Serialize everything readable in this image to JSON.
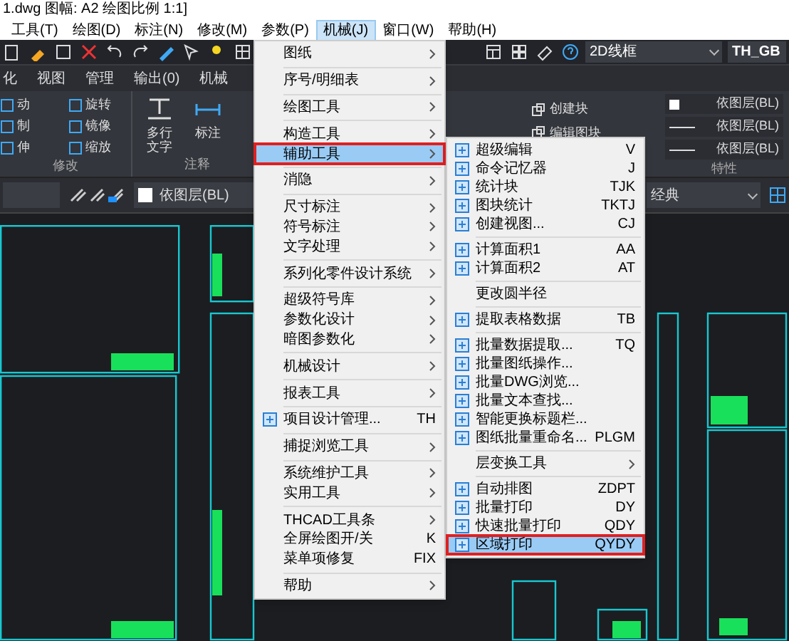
{
  "window": {
    "title": "1.dwg 图幅: A2 绘图比例 1:1]"
  },
  "menu_bar": [
    {
      "label": "工具(T)",
      "selected": false
    },
    {
      "label": "绘图(D)",
      "selected": false
    },
    {
      "label": "标注(N)",
      "selected": false
    },
    {
      "label": "修改(M)",
      "selected": false
    },
    {
      "label": "参数(P)",
      "selected": false
    },
    {
      "label": "机械(J)",
      "selected": true
    },
    {
      "label": "窗口(W)",
      "selected": false
    },
    {
      "label": "帮助(H)",
      "selected": false
    }
  ],
  "toolbar": {
    "visual_style": "2D线框",
    "text_style": "TH_GB"
  },
  "ribbon_tabs": [
    "化",
    "视图",
    "管理",
    "输出(0)",
    "机械"
  ],
  "ribbon": {
    "modify_tools": [
      "动",
      "旋转",
      "制",
      "镜像",
      "伸",
      "缩放"
    ],
    "annotation_tools": [
      "多行文字",
      "标注"
    ],
    "block_tools": [
      "创建块",
      "编辑图块"
    ],
    "properties": [
      "依图层(BL)",
      "依图层(BL)",
      "依图层(BL)"
    ],
    "panel_labels": [
      "修改",
      "注释",
      "特性"
    ]
  },
  "properties_bar": {
    "layer": "依图层(BL)",
    "workspace": "经典"
  },
  "menu": {
    "groups": [
      [
        {
          "label": "图纸",
          "submenu": true,
          "selected": false
        }
      ],
      [
        {
          "label": "序号/明细表",
          "submenu": true,
          "selected": false
        }
      ],
      [
        {
          "label": "绘图工具",
          "submenu": true,
          "selected": false
        }
      ],
      [
        {
          "label": "构造工具",
          "submenu": true,
          "selected": false
        },
        {
          "label": "辅助工具",
          "submenu": true,
          "selected": true
        }
      ],
      [
        {
          "label": "消隐",
          "submenu": true,
          "selected": false
        }
      ],
      [
        {
          "label": "尺寸标注",
          "submenu": true,
          "selected": false
        },
        {
          "label": "符号标注",
          "submenu": true,
          "selected": false
        },
        {
          "label": "文字处理",
          "submenu": true,
          "selected": false
        }
      ],
      [
        {
          "label": "系列化零件设计系统",
          "submenu": true,
          "selected": false
        }
      ],
      [
        {
          "label": "超级符号库",
          "submenu": true,
          "selected": false
        },
        {
          "label": "参数化设计",
          "submenu": true,
          "selected": false
        },
        {
          "label": "暗图参数化",
          "submenu": true,
          "selected": false
        }
      ],
      [
        {
          "label": "机械设计",
          "submenu": true,
          "selected": false
        }
      ],
      [
        {
          "label": "报表工具",
          "submenu": true,
          "selected": false
        }
      ],
      [
        {
          "label": "项目设计管理...",
          "shortcut": "TH",
          "icon": true,
          "submenu": false,
          "selected": false
        }
      ],
      [
        {
          "label": "捕捉浏览工具",
          "submenu": true,
          "selected": false
        }
      ],
      [
        {
          "label": "系统维护工具",
          "submenu": true,
          "selected": false
        },
        {
          "label": "实用工具",
          "submenu": true,
          "selected": false
        }
      ],
      [
        {
          "label": "THCAD工具条",
          "submenu": true,
          "selected": false
        },
        {
          "label": "全屏绘图开/关",
          "shortcut": "K",
          "submenu": false,
          "selected": false
        },
        {
          "label": "菜单项修复",
          "shortcut": "FIX",
          "submenu": false,
          "selected": false
        }
      ],
      [
        {
          "label": "帮助",
          "submenu": true,
          "selected": false
        }
      ]
    ]
  },
  "submenu": {
    "groups": [
      [
        {
          "label": "超级编辑",
          "shortcut": "V",
          "icon": true,
          "submenu": false,
          "selected": false
        },
        {
          "label": "命令记忆器",
          "shortcut": "J",
          "icon": true,
          "submenu": false,
          "selected": false
        },
        {
          "label": "统计块",
          "shortcut": "TJK",
          "icon": true,
          "submenu": false,
          "selected": false
        },
        {
          "label": "图块统计",
          "shortcut": "TKTJ",
          "icon": true,
          "submenu": false,
          "selected": false
        },
        {
          "label": "创建视图...",
          "shortcut": "CJ",
          "icon": true,
          "submenu": false,
          "selected": false
        }
      ],
      [
        {
          "label": "计算面积1",
          "shortcut": "AA",
          "icon": true,
          "submenu": false,
          "selected": false
        },
        {
          "label": "计算面积2",
          "shortcut": "AT",
          "icon": true,
          "submenu": false,
          "selected": false
        }
      ],
      [
        {
          "label": "更改圆半径",
          "icon": false,
          "submenu": false,
          "selected": false
        }
      ],
      [
        {
          "label": "提取表格数据",
          "shortcut": "TB",
          "icon": true,
          "submenu": false,
          "selected": false
        }
      ],
      [
        {
          "label": "批量数据提取...",
          "shortcut": "TQ",
          "icon": true,
          "submenu": false,
          "selected": false
        },
        {
          "label": "批量图纸操作...",
          "icon": true,
          "submenu": false,
          "selected": false
        },
        {
          "label": "批量DWG浏览...",
          "icon": true,
          "submenu": false,
          "selected": false
        },
        {
          "label": "批量文本查找...",
          "icon": true,
          "submenu": false,
          "selected": false
        },
        {
          "label": "智能更换标题栏...",
          "icon": true,
          "submenu": false,
          "selected": false
        },
        {
          "label": "图纸批量重命名...",
          "shortcut": "PLGM",
          "icon": true,
          "submenu": false,
          "selected": false
        }
      ],
      [
        {
          "label": "层变换工具",
          "icon": false,
          "submenu": true,
          "selected": false
        }
      ],
      [
        {
          "label": "自动排图",
          "shortcut": "ZDPT",
          "icon": true,
          "submenu": false,
          "selected": false
        },
        {
          "label": "批量打印",
          "shortcut": "DY",
          "icon": true,
          "submenu": false,
          "selected": false
        },
        {
          "label": "快速批量打印",
          "shortcut": "QDY",
          "icon": true,
          "submenu": false,
          "selected": false
        },
        {
          "label": "区域打印",
          "shortcut": "QYDY",
          "icon": true,
          "submenu": false,
          "selected": true
        }
      ]
    ]
  }
}
